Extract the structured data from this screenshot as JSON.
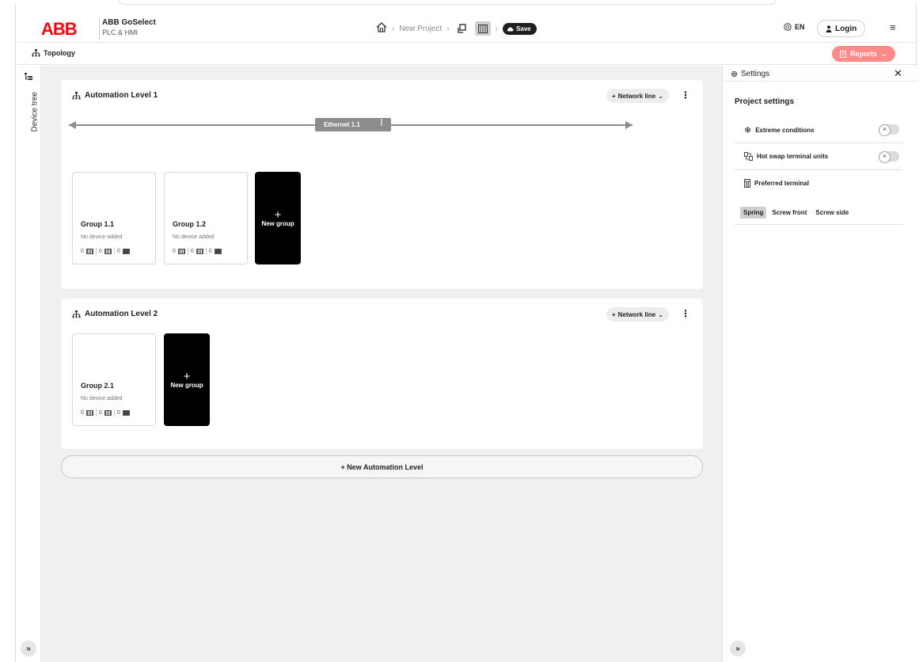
{
  "header": {
    "logo": "ABB",
    "app_name": "ABB GoSelect",
    "app_sub": "PLC & HMI",
    "breadcrumb": {
      "project": "New Project",
      "save_label": "Save"
    },
    "language": "EN",
    "login_label": "Login"
  },
  "toolbar": {
    "topology_label": "Topology",
    "reports_label": "Reports"
  },
  "rail": {
    "device_tree_label": "Device tree"
  },
  "levels": [
    {
      "title": "Automation Level 1",
      "network_btn": "Network line",
      "network": {
        "label": "Ethernet 1.1"
      },
      "groups": [
        {
          "title": "Group 1.1",
          "status": "No device added",
          "counts": [
            "0",
            "0",
            "0"
          ]
        },
        {
          "title": "Group 1.2",
          "status": "No device added",
          "counts": [
            "0",
            "0",
            "0"
          ]
        }
      ],
      "new_group_label": "New group"
    },
    {
      "title": "Automation Level 2",
      "network_btn": "Network line",
      "groups": [
        {
          "title": "Group 2.1",
          "status": "No device added",
          "counts": [
            "0",
            "0",
            "0"
          ]
        }
      ],
      "new_group_label": "New group"
    }
  ],
  "new_level_label": "+ New Automation Level",
  "settings": {
    "title": "Settings",
    "project_title": "Project settings",
    "options": [
      {
        "label": "Extreme conditions",
        "enabled": false
      },
      {
        "label": "Hot swap terminal units",
        "enabled": false
      }
    ],
    "preferred_terminal": {
      "label": "Preferred terminal",
      "choices": [
        "Spring",
        "Screw front",
        "Screw side"
      ],
      "selected": "Spring"
    }
  },
  "colors": {
    "brand": "#ff000f",
    "reports": "#ff8a8a",
    "network": "#8c8c8c"
  }
}
